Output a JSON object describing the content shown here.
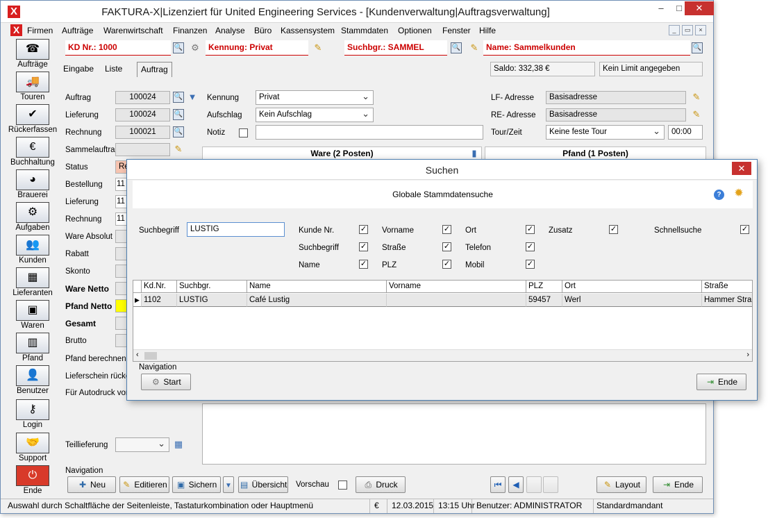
{
  "window": {
    "title": "FAKTURA-X|Lizenziert für United Engineering Services - [Kundenverwaltung|Auftragsverwaltung]",
    "app_icon": "X",
    "min": "–",
    "max": "□",
    "close": "✕"
  },
  "menu": {
    "items": [
      "Firmen",
      "Aufträge",
      "Warenwirtschaft",
      "Finanzen",
      "Analyse",
      "Büro",
      "Kassensystem",
      "Stammdaten",
      "Optionen",
      "Fenster",
      "Hilfe"
    ],
    "mdi": [
      "_",
      "▭",
      "×"
    ]
  },
  "sidebar": {
    "items": [
      {
        "label": "Aufträge",
        "icon": "headset-icon"
      },
      {
        "label": "Touren",
        "icon": "truck-icon"
      },
      {
        "label": "Rückerfassen",
        "icon": "truck-check-icon"
      },
      {
        "label": "Buchhaltung",
        "icon": "money-icon"
      },
      {
        "label": "Brauerei",
        "icon": "beer-chart-icon"
      },
      {
        "label": "Aufgaben",
        "icon": "tasks-icon"
      },
      {
        "label": "Kunden",
        "icon": "people-icon"
      },
      {
        "label": "Lieferanten",
        "icon": "supplier-icon"
      },
      {
        "label": "Waren",
        "icon": "goods-icon"
      },
      {
        "label": "Pfand",
        "icon": "bottles-icon"
      },
      {
        "label": "Benutzer",
        "icon": "user-lock-icon"
      },
      {
        "label": "Login",
        "icon": "key-icon"
      },
      {
        "label": "Support",
        "icon": "handshake-icon"
      },
      {
        "label": "Ende",
        "icon": "power-icon"
      }
    ]
  },
  "header": {
    "kd_nr": "KD Nr.: 1000",
    "kennung": "Kennung: Privat",
    "suchbgr": "Suchbgr.: SAMMEL",
    "name": "Name: Sammelkunden"
  },
  "tabs": [
    "Eingabe",
    "Liste",
    "Auftrag"
  ],
  "saldo": "Saldo: 332,38 €",
  "limit": "Kein Limit angegeben",
  "left_form": {
    "auftrag_label": "Auftrag",
    "auftrag": "100024",
    "lieferung_label": "Lieferung",
    "lieferung": "100024",
    "rechnung_label": "Rechnung",
    "rechnung": "100021",
    "sammelauftrag_label": "Sammelauftrag",
    "status_label": "Status",
    "status_value": "Re",
    "bestellung_label": "Bestellung",
    "bestellung_value": "11",
    "lieferung2_label": "Lieferung",
    "lieferung2_value": "11",
    "rechnung2_label": "Rechnung",
    "rechnung2_value": "11",
    "ware_absolut": "Ware Absolut",
    "rabatt": "Rabatt",
    "skonto": "Skonto",
    "ware_netto": "Ware Netto",
    "pfand_netto": "Pfand Netto",
    "gesamt": "Gesamt",
    "brutto": "Brutto",
    "pfand_berechnen": "Pfand berechnen",
    "lieferschein": "Lieferschein rücke",
    "autodruck": "Für Autodruck vorm",
    "teillieferung": "Teillieferung"
  },
  "mid_form": {
    "kennung_label": "Kennung",
    "kennung_value": "Privat",
    "aufschlag_label": "Aufschlag",
    "aufschlag_value": "Kein Aufschlag",
    "notiz_label": "Notiz"
  },
  "right_form": {
    "lf_label": "LF- Adresse",
    "lf_value": "Basisadresse",
    "re_label": "RE- Adresse",
    "re_value": "Basisadresse",
    "tour_label": "Tour/Zeit",
    "tour_value": "Keine feste Tour",
    "time_value": "00:00"
  },
  "panels": {
    "ware": "Ware (2 Posten)",
    "pfand": "Pfand (1 Posten)"
  },
  "bottom_nav": {
    "label": "Navigation",
    "neu": "Neu",
    "editieren": "Editieren",
    "sichern": "Sichern",
    "uebersicht": "Übersicht",
    "vorschau": "Vorschau",
    "druck": "Druck",
    "layout": "Layout",
    "ende": "Ende"
  },
  "status_bar": {
    "hint": "Auswahl durch Schaltfläche der Seitenleiste, Tastaturkombination oder Hauptmenü",
    "currency": "€",
    "date": "12.03.2015",
    "time": "13:15 Uhr",
    "user": "Benutzer: ADMINISTRATOR",
    "mandant": "Standardmandant"
  },
  "dialog": {
    "title": "Suchen",
    "heading": "Globale Stammdatensuche",
    "suchbegriff_label": "Suchbegriff",
    "suchbegriff_value": "LUSTIG",
    "checks": [
      {
        "label": "Kunde Nr."
      },
      {
        "label": "Vorname"
      },
      {
        "label": "Ort"
      },
      {
        "label": "Zusatz"
      },
      {
        "label": "Schnellsuche"
      },
      {
        "label": "Suchbegriff"
      },
      {
        "label": "Straße"
      },
      {
        "label": "Telefon"
      },
      {
        "label": "Name"
      },
      {
        "label": "PLZ"
      },
      {
        "label": "Mobil"
      }
    ],
    "grid": {
      "columns": [
        "Kd.Nr.",
        "Suchbgr.",
        "Name",
        "Vorname",
        "PLZ",
        "Ort",
        "Straße"
      ],
      "rows": [
        [
          "1102",
          "LUSTIG",
          "Café Lustig",
          "",
          "59457",
          "Werl",
          "Hammer Straß"
        ]
      ]
    },
    "nav_label": "Navigation",
    "start": "Start",
    "ende": "Ende",
    "check_mark": "✓"
  },
  "colors": {
    "brand_red": "#d81e1e",
    "header_text": "#cc0000",
    "pfand_netto_highlight": "#ffff00",
    "status_highlight": "#f7c4b0"
  }
}
